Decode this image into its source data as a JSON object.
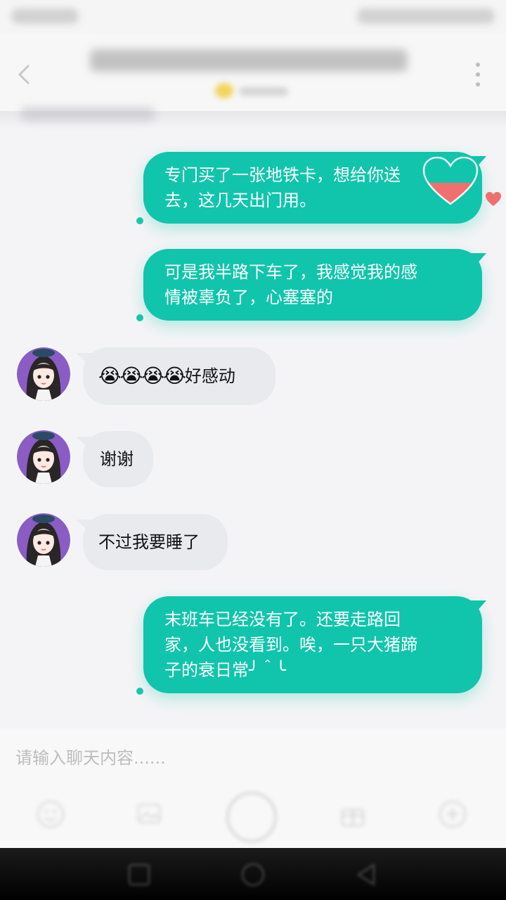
{
  "chat": {
    "input_placeholder": "请输入聊天内容......"
  },
  "messages": [
    {
      "direction": "out",
      "text_lines": [
        "专门买了一张地铁卡，想给你送",
        "去，这几天出门用。"
      ],
      "liked": true
    },
    {
      "direction": "out",
      "text_lines": [
        "可是我半路下车了，我感觉我的感",
        "情被辜负了，心塞塞的"
      ]
    },
    {
      "direction": "in",
      "emoji": "😭😭😭😭",
      "text": "好感动"
    },
    {
      "direction": "in",
      "text": "谢谢"
    },
    {
      "direction": "in",
      "text": "不过我要睡了"
    },
    {
      "direction": "out",
      "text_lines": [
        "末班车已经没有了。还要走路回",
        "家，人也没看到。唉，一只大猪蹄",
        "子的衰日常╯＾╰"
      ]
    }
  ],
  "colors": {
    "outgoing_bubble": "#10c5ac",
    "incoming_bubble": "#e8eaee",
    "like_heart": "#f07070",
    "background": "#f4f4f6"
  },
  "icons": {
    "back": "chevron-left-icon",
    "more": "more-vertical-icon",
    "like": "heart-icon"
  }
}
